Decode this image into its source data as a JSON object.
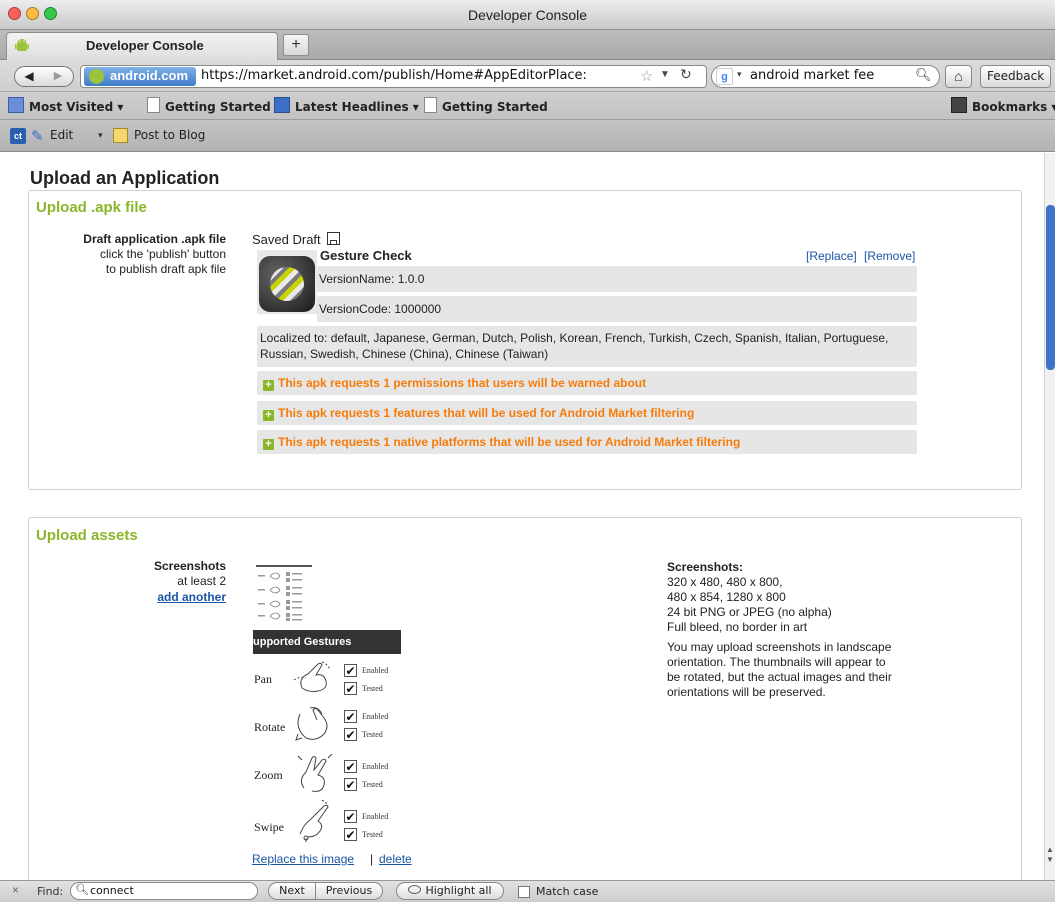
{
  "window": {
    "title": "Developer Console"
  },
  "tabs": [
    {
      "label": "Developer Console",
      "close": "×"
    }
  ],
  "new_tab": "+",
  "nav": {
    "back": "◀",
    "forward": "▶",
    "identity": "android.com",
    "url": "https://market.android.com/publish/Home#AppEditorPlace:",
    "search_engine": "g",
    "search_query": "android market fee",
    "home": "⌂",
    "feedback": "Feedback ▾"
  },
  "bookmarks": {
    "most_visited": "Most Visited ▾",
    "getting_started_1": "Getting Started",
    "latest_headlines": "Latest Headlines ▾",
    "getting_started_2": "Getting Started",
    "bookmarks": "Bookmarks ▾"
  },
  "toolbar2": {
    "ct": "ct",
    "edit": "Edit",
    "post_to_blog": "Post to Blog"
  },
  "page": {
    "title": "Upload an Application",
    "apk_section": {
      "title": "Upload .apk file",
      "draft_label": "Draft application .apk file",
      "draft_hint_1": "click the 'publish' button",
      "draft_hint_2": "to publish draft apk file",
      "saved_draft": "Saved Draft",
      "app_name": "Gesture Check",
      "replace": "[Replace]",
      "remove": "[Remove]",
      "version_name": "VersionName: 1.0.0",
      "version_code": "VersionCode: 1000000",
      "localized": "Localized to: default, Japanese, German, Dutch, Polish, Korean, French, Turkish, Czech, Spanish, Italian, Portuguese, Russian, Swedish, Chinese (China), Chinese (Taiwan)",
      "warnings": [
        "This apk requests 1 permissions that users will be warned about",
        "This apk requests 1 features that will be used for Android Market filtering",
        "This apk requests 1 native platforms that will be used for Android Market filtering"
      ]
    },
    "assets_section": {
      "title": "Upload assets",
      "screenshots_label": "Screenshots",
      "screenshots_hint": "at least 2",
      "add_another": "add another",
      "screenshot": {
        "header": "upported Gestures",
        "gestures": [
          {
            "label": "Pan",
            "enabled": "Enabled",
            "tested": "Tested"
          },
          {
            "label": "Rotate",
            "enabled": "Enabled",
            "tested": "Tested"
          },
          {
            "label": "Zoom",
            "enabled": "Enabled",
            "tested": "Tested"
          },
          {
            "label": "Swipe",
            "enabled": "Enabled",
            "tested": "Tested"
          }
        ]
      },
      "replace_image": "Replace this image",
      "separator": "|",
      "delete": "delete",
      "requirements": {
        "title": "Screenshots:",
        "lines": [
          "320 x 480, 480 x 800,",
          "480 x 854, 1280 x 800",
          "24 bit PNG or JPEG (no alpha)",
          "Full bleed, no border in art",
          "You may upload screenshots in landscape",
          "orientation. The thumbnails will appear to",
          "be rotated, but the actual images and their",
          "orientations will be preserved."
        ]
      }
    }
  },
  "findbar": {
    "close": "×",
    "label": "Find:",
    "query": "connect",
    "next": "Next",
    "previous": "Previous",
    "highlight_all": "Highlight all",
    "match_case": "Match case"
  },
  "colors": {
    "section_title": "#8ab62a",
    "warning": "#f57c0a",
    "link": "#1a55a6"
  }
}
